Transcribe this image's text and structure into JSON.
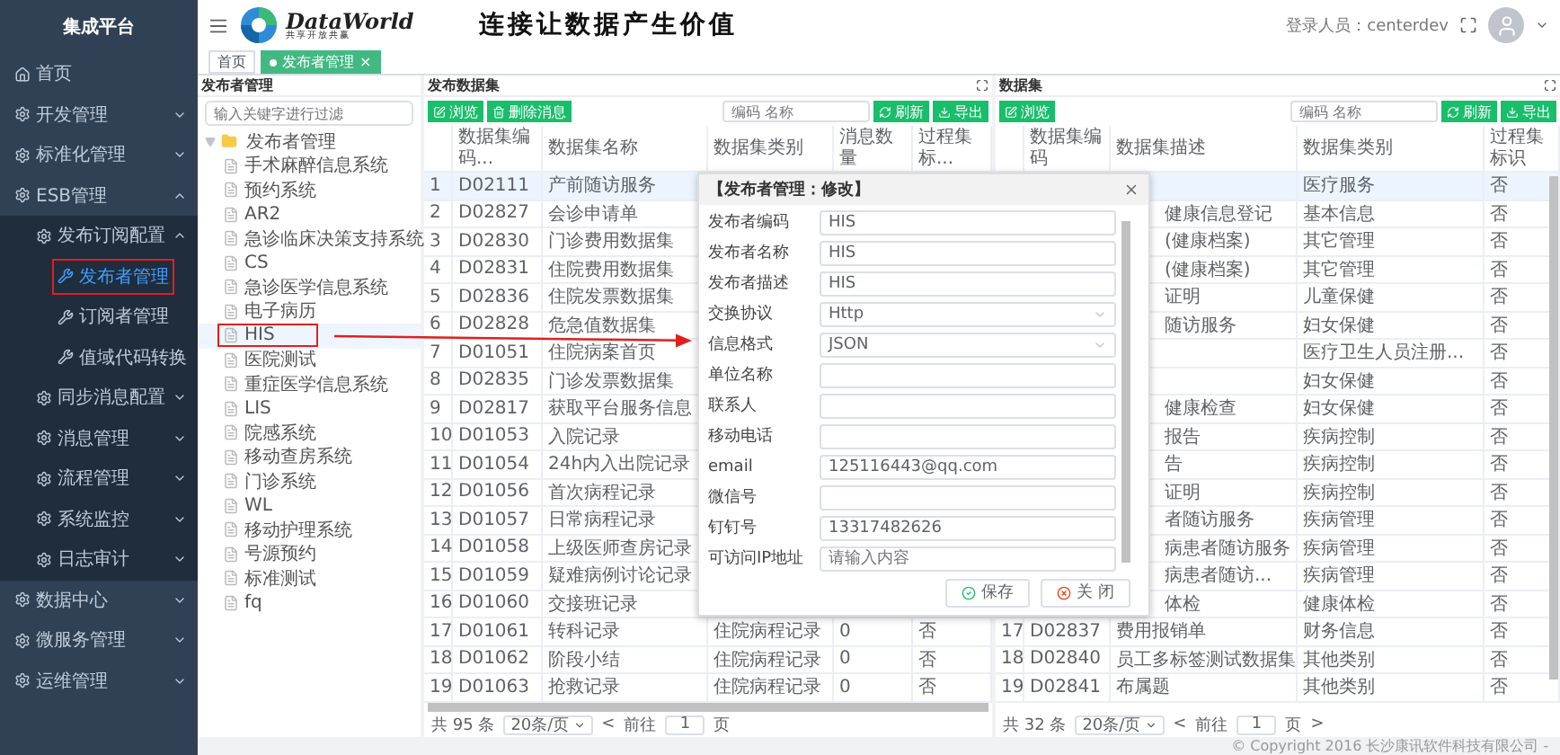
{
  "sidebar": {
    "title": "集成平台",
    "items": [
      {
        "label": "首页",
        "kind": "home",
        "selected": false
      },
      {
        "label": "开发管理",
        "kind": "group",
        "selected": false,
        "expanded": false
      },
      {
        "label": "标准化管理",
        "kind": "group",
        "selected": false,
        "expanded": false
      },
      {
        "label": "ESB管理",
        "kind": "group",
        "selected": false,
        "expanded": true,
        "children": [
          {
            "label": "发布订阅配置",
            "kind": "group",
            "selected": false,
            "expanded": true,
            "children": [
              {
                "label": "发布者管理",
                "kind": "page",
                "selected": true,
                "highlight_box": true
              },
              {
                "label": "订阅者管理",
                "kind": "page",
                "selected": false
              },
              {
                "label": "值域代码转换",
                "kind": "page",
                "selected": false
              }
            ]
          },
          {
            "label": "同步消息配置",
            "kind": "group",
            "selected": false,
            "expanded": false
          },
          {
            "label": "消息管理",
            "kind": "group",
            "selected": false,
            "expanded": false
          },
          {
            "label": "流程管理",
            "kind": "group",
            "selected": false,
            "expanded": false
          },
          {
            "label": "系统监控",
            "kind": "group",
            "selected": false,
            "expanded": false
          },
          {
            "label": "日志审计",
            "kind": "group",
            "selected": false,
            "expanded": false
          }
        ]
      },
      {
        "label": "数据中心",
        "kind": "group",
        "selected": false,
        "expanded": false
      },
      {
        "label": "微服务管理",
        "kind": "group",
        "selected": false,
        "expanded": false
      },
      {
        "label": "运维管理",
        "kind": "group",
        "selected": false,
        "expanded": false
      }
    ]
  },
  "header": {
    "logo_name": "DataWorld",
    "logo_tagline": "共享开放共赢",
    "slogan": "连接让数据产生价值",
    "user": "登录人员：centerdev"
  },
  "tabs": [
    {
      "label": "首页",
      "selected": false
    },
    {
      "label": "发布者管理",
      "selected": true,
      "close": "×"
    }
  ],
  "tree_panel": {
    "title": "发布者管理",
    "filter_placeholder": "输入关键字进行过滤",
    "root": {
      "label": "发布者管理",
      "expanded": true,
      "children": [
        {
          "label": "手术麻醉信息系统",
          "selected": false
        },
        {
          "label": "预约系统",
          "selected": false
        },
        {
          "label": "AR2",
          "selected": false
        },
        {
          "label": "急诊临床决策支持系统",
          "selected": false
        },
        {
          "label": "CS",
          "selected": false
        },
        {
          "label": "急诊医学信息系统",
          "selected": false
        },
        {
          "label": "电子病历",
          "selected": false
        },
        {
          "label": "HIS",
          "selected": true,
          "highlight_box": true
        },
        {
          "label": "医院测试",
          "selected": false
        },
        {
          "label": "重症医学信息系统",
          "selected": false
        },
        {
          "label": "LIS",
          "selected": false
        },
        {
          "label": "院感系统",
          "selected": false
        },
        {
          "label": "移动查房系统",
          "selected": false
        },
        {
          "label": "门诊系统",
          "selected": false
        },
        {
          "label": "WL",
          "selected": false
        },
        {
          "label": "移动护理系统",
          "selected": false
        },
        {
          "label": "号源预约",
          "selected": false
        },
        {
          "label": "标准测试",
          "selected": false
        },
        {
          "label": "fq",
          "selected": false
        }
      ]
    }
  },
  "publish_panel": {
    "title": "发布数据集",
    "buttons": [
      {
        "label": "浏览",
        "kind": "edit"
      },
      {
        "label": "删除消息",
        "kind": "delete"
      }
    ],
    "search_placeholder": "编码 名称",
    "actions": [
      {
        "label": "刷新",
        "kind": "refresh"
      },
      {
        "label": "导出",
        "kind": "export"
      }
    ],
    "columns": [
      "数据集编码...",
      "数据集名称",
      "数据集类别",
      "消息数量",
      "过程集标..."
    ],
    "rows": [
      {
        "index": "1",
        "code": "D02111",
        "name": "产前随访服务",
        "selected": true
      },
      {
        "index": "2",
        "code": "D02827",
        "name": "会诊申请单",
        "selected": false
      },
      {
        "index": "3",
        "code": "D02830",
        "name": "门诊费用数据集",
        "selected": false
      },
      {
        "index": "4",
        "code": "D02831",
        "name": "住院费用数据集",
        "selected": false
      },
      {
        "index": "5",
        "code": "D02836",
        "name": "住院发票数据集",
        "selected": false
      },
      {
        "index": "6",
        "code": "D02828",
        "name": "危急值数据集",
        "selected": false
      },
      {
        "index": "7",
        "code": "D01051",
        "name": "住院病案首页",
        "selected": false
      },
      {
        "index": "8",
        "code": "D02835",
        "name": "门诊发票数据集",
        "selected": false
      },
      {
        "index": "9",
        "code": "D02817",
        "name": "获取平台服务信息",
        "selected": false
      },
      {
        "index": "10",
        "code": "D01053",
        "name": "入院记录",
        "selected": false
      },
      {
        "index": "11",
        "code": "D01054",
        "name": "24h内入出院记录",
        "selected": false
      },
      {
        "index": "12",
        "code": "D01056",
        "name": "首次病程记录",
        "selected": false
      },
      {
        "index": "13",
        "code": "D01057",
        "name": "日常病程记录",
        "selected": false
      },
      {
        "index": "14",
        "code": "D01058",
        "name": "上级医师查房记录",
        "selected": false
      },
      {
        "index": "15",
        "code": "D01059",
        "name": "疑难病例讨论记录",
        "selected": false
      },
      {
        "index": "16",
        "code": "D01060",
        "name": "交接班记录",
        "selected": false
      },
      {
        "index": "17",
        "code": "D01061",
        "name": "转科记录",
        "category": "住院病程记录",
        "count": "0",
        "flag": "否",
        "selected": false
      },
      {
        "index": "18",
        "code": "D01062",
        "name": "阶段小结",
        "category": "住院病程记录",
        "count": "0",
        "flag": "否",
        "selected": false
      },
      {
        "index": "19",
        "code": "D01063",
        "name": "抢救记录",
        "category": "住院病程记录",
        "count": "0",
        "flag": "否",
        "selected": false
      }
    ],
    "pagination": {
      "total": "共 95 条",
      "page_size": "20条/页",
      "prev": "<",
      "goto": "前往",
      "page": "1",
      "unit": "页"
    }
  },
  "dataset_panel": {
    "title": "数据集",
    "buttons": [
      {
        "label": "浏览",
        "kind": "edit"
      }
    ],
    "search_placeholder": "编码 名称",
    "actions": [
      {
        "label": "刷新",
        "kind": "refresh"
      },
      {
        "label": "导出",
        "kind": "export"
      }
    ],
    "columns": [
      "数据集编码",
      "数据集描述",
      "数据集类别",
      "过程集标识"
    ],
    "rows": [
      {
        "category": "医疗服务",
        "flag": "否",
        "selected": true
      },
      {
        "description": "健康信息登记",
        "category": "基本信息",
        "flag": "否",
        "selected": false
      },
      {
        "description": "(健康档案)",
        "category": "其它管理",
        "flag": "否",
        "selected": false
      },
      {
        "description": "(健康档案)",
        "category": "其它管理",
        "flag": "否",
        "selected": false
      },
      {
        "description": "证明",
        "category": "儿童保健",
        "flag": "否",
        "selected": false
      },
      {
        "description": "随访服务",
        "category": "妇女保健",
        "flag": "否",
        "selected": false
      },
      {
        "category": "医疗卫生人员注册...",
        "flag": "否",
        "selected": false
      },
      {
        "category": "妇女保健",
        "flag": "否",
        "selected": false
      },
      {
        "description": "健康检查",
        "category": "妇女保健",
        "flag": "否",
        "selected": false
      },
      {
        "description": "报告",
        "category": "疾病控制",
        "flag": "否",
        "selected": false
      },
      {
        "description": "告",
        "category": "疾病控制",
        "flag": "否",
        "selected": false
      },
      {
        "description": "证明",
        "category": "疾病控制",
        "flag": "否",
        "selected": false
      },
      {
        "description": "者随访服务",
        "category": "疾病管理",
        "flag": "否",
        "selected": false
      },
      {
        "description": "病患者随访服务",
        "category": "疾病管理",
        "flag": "否",
        "selected": false
      },
      {
        "description": "病患者随访...",
        "category": "疾病管理",
        "flag": "否",
        "selected": false
      },
      {
        "description": "体检",
        "category": "健康体检",
        "flag": "否",
        "selected": false
      },
      {
        "index": "17",
        "code": "D02837",
        "description": "费用报销单",
        "category": "财务信息",
        "flag": "否",
        "selected": false
      },
      {
        "index": "18",
        "code": "D02840",
        "description": "员工多标签测试数据集",
        "category": "其他类别",
        "flag": "否",
        "selected": false
      },
      {
        "index": "19",
        "code": "D02841",
        "description": "布属题",
        "category": "其他类别",
        "flag": "否",
        "selected": false
      }
    ],
    "pagination": {
      "total": "共 32 条",
      "page_size": "20条/页",
      "prev": "<",
      "goto": "前往",
      "page": "1",
      "unit": "页",
      "next": ">"
    }
  },
  "dialog": {
    "title": "【发布者管理：修改】",
    "fields": [
      {
        "label": "发布者编码",
        "kind": "text",
        "value": "HIS"
      },
      {
        "label": "发布者名称",
        "kind": "text",
        "value": "HIS"
      },
      {
        "label": "发布者描述",
        "kind": "text",
        "value": "HIS"
      },
      {
        "label": "交换协议",
        "kind": "select",
        "value": "Http"
      },
      {
        "label": "信息格式",
        "kind": "select",
        "value": "JSON"
      },
      {
        "label": "单位名称",
        "kind": "text"
      },
      {
        "label": "联系人",
        "kind": "text"
      },
      {
        "label": "移动电话",
        "kind": "text"
      },
      {
        "label": "email",
        "kind": "text",
        "value": "125116443@qq.com"
      },
      {
        "label": "微信号",
        "kind": "text"
      },
      {
        "label": "钉钉号",
        "kind": "text",
        "value": "13317482626"
      },
      {
        "label": "可访问IP地址",
        "kind": "text",
        "placeholder": "请输入内容"
      }
    ],
    "buttons": [
      {
        "label": "保存",
        "kind": "save"
      },
      {
        "label": "关 闭",
        "kind": "close"
      }
    ]
  },
  "copyright": "© Copyright 2016 长沙康讯软件科技有限公司 -"
}
